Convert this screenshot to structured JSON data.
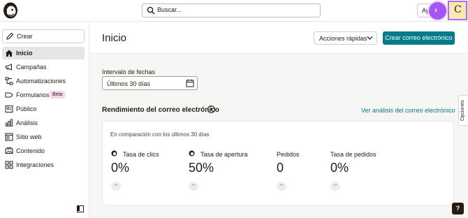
{
  "search": {
    "placeholder": "Buscar..."
  },
  "top": {
    "help_label": "Ayuda",
    "avatar_initial": "C",
    "fab_symbol": "›"
  },
  "sidebar": {
    "create_label": "Crear",
    "items": [
      {
        "label": "Inicio",
        "icon": "home-icon",
        "active": true
      },
      {
        "label": "Campañas",
        "icon": "megaphone-icon"
      },
      {
        "label": "Automatizaciones",
        "icon": "automation-icon"
      },
      {
        "label": "Formularios",
        "icon": "form-icon",
        "badge": "Beta"
      },
      {
        "label": "Público",
        "icon": "audience-icon"
      },
      {
        "label": "Análisis",
        "icon": "analytics-icon"
      },
      {
        "label": "Sitio web",
        "icon": "website-icon"
      },
      {
        "label": "Contenido",
        "icon": "content-icon"
      },
      {
        "label": "Integraciones",
        "icon": "integrations-icon"
      }
    ]
  },
  "header": {
    "title": "Inicio",
    "quick_actions": "Acciones rápidas",
    "create_email": "Crear correo electrónico"
  },
  "main": {
    "date_label": "Intervalo de fechas",
    "date_value": "Últimos 30 días",
    "perf_title": "Rendimiento del correo electrónico",
    "view_link": "Ver análisis del correo electrónico →",
    "options_label": "Opciones",
    "compare_text": "En comparación con los últimos 30 días",
    "metrics": [
      {
        "label": "Tasa de clics",
        "value": "0%",
        "delta": "--"
      },
      {
        "label": "Tasa de apertura",
        "value": "50%",
        "delta": "--"
      },
      {
        "label": "Pedidos",
        "value": "0",
        "delta": "--"
      },
      {
        "label": "Tasa de pedidos",
        "value": "0%",
        "delta": "--"
      }
    ]
  },
  "help_button": "?",
  "colors": {
    "accent": "#007c89",
    "fab": "#a855f7",
    "avatar_bg": "#f7e9b0",
    "badge_bg": "#f6d6ea"
  }
}
